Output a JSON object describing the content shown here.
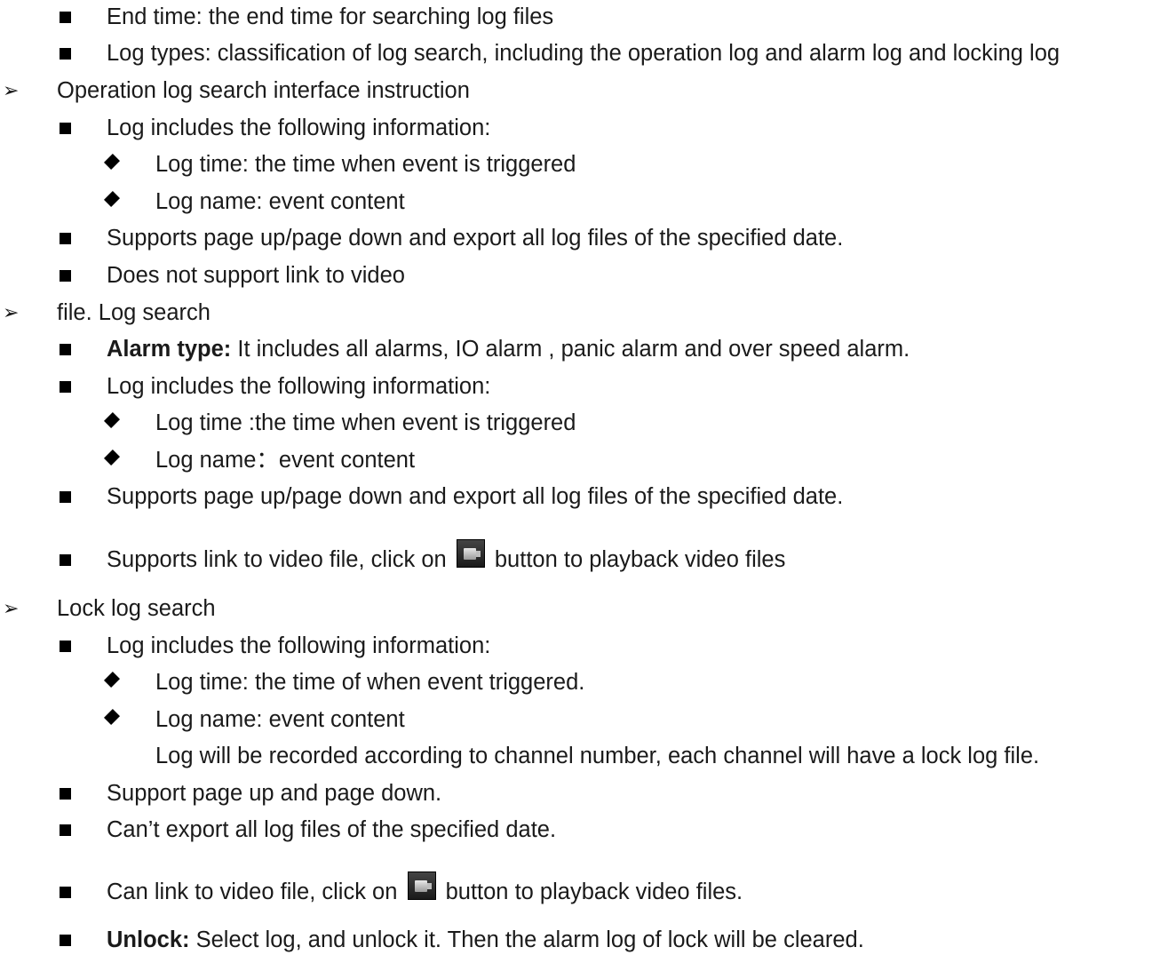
{
  "items": [
    {
      "level": 2,
      "text": "End time: the end time for searching log files"
    },
    {
      "level": 2,
      "text": "Log types: classification of log search, including the operation log and alarm log and locking log"
    },
    {
      "level": 1,
      "text": "Operation log search interface instruction"
    },
    {
      "level": 2,
      "text": "Log includes the following information:"
    },
    {
      "level": 3,
      "text": "Log time: the time when event is triggered"
    },
    {
      "level": 3,
      "text": "Log name: event content"
    },
    {
      "level": 2,
      "text": "Supports page up/page down and export all log files of the specified date."
    },
    {
      "level": 2,
      "text": "Does not support link to video"
    },
    {
      "level": 1,
      "text": "file. Log search"
    },
    {
      "level": 2,
      "bold": "Alarm type:",
      "text": " It includes all alarms, IO alarm , panic alarm and over speed alarm."
    },
    {
      "level": 2,
      "text": "Log includes the following information:"
    },
    {
      "level": 3,
      "text": "Log time :the time when event is triggered"
    },
    {
      "level": 3,
      "text": "Log name：event content"
    },
    {
      "level": 2,
      "text": "Supports page up/page down and export all log files of the specified date."
    },
    {
      "level": 2,
      "text": "Supports link to video file, click on",
      "after": "button to playback video files",
      "icon": "playback-button-icon"
    },
    {
      "level": 1,
      "text": "Lock log search"
    },
    {
      "level": 2,
      "text": "Log includes the following information:"
    },
    {
      "level": 3,
      "text": "Log time: the time of when event triggered."
    },
    {
      "level": 3,
      "text": "Log name: event content"
    },
    {
      "level": 4,
      "text": "Log will be recorded according to channel number, each channel will have a lock log file."
    },
    {
      "level": 2,
      "text": "Support page up and page down."
    },
    {
      "level": 2,
      "text": "Can’t export all log files of the specified date."
    },
    {
      "level": 2,
      "text": "Can link to video file, click on",
      "after": "button to playback video files.",
      "icon": "playback-button-icon"
    },
    {
      "level": 2,
      "bold": "Unlock:",
      "text": " Select log, and unlock it. Then the alarm log of lock will be cleared."
    }
  ],
  "bullets": {
    "level1": "➢"
  }
}
